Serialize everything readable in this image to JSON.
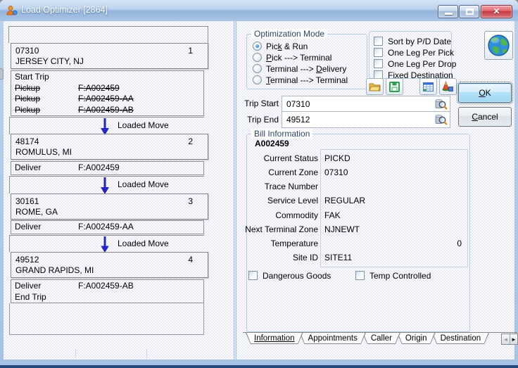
{
  "window": {
    "title": "Load Optimizer [2864]"
  },
  "trip_panel": {
    "connector_label": "Loaded Move",
    "stops": [
      {
        "zone": "07310",
        "city": "JERSEY CITY, NJ",
        "seq": "1",
        "actions": [
          {
            "label": "Start Trip",
            "value": "",
            "struck": false
          },
          {
            "label": "Pickup",
            "value": "F:A002459",
            "struck": true
          },
          {
            "label": "Pickup",
            "value": "F:A002459-AA",
            "struck": true
          },
          {
            "label": "Pickup",
            "value": "F:A002459-AB",
            "struck": true
          }
        ]
      },
      {
        "zone": "48174",
        "city": "ROMULUS, MI",
        "seq": "2",
        "actions": [
          {
            "label": "Deliver",
            "value": "F:A002459",
            "struck": false
          }
        ]
      },
      {
        "zone": "30161",
        "city": "ROME, GA",
        "seq": "3",
        "actions": [
          {
            "label": "Deliver",
            "value": "F:A002459-AA",
            "struck": false
          }
        ]
      },
      {
        "zone": "49512",
        "city": "GRAND RAPIDS, MI",
        "seq": "4",
        "actions": [
          {
            "label": "Deliver",
            "value": "F:A002459-AB",
            "struck": false
          },
          {
            "label": "End Trip",
            "value": "",
            "struck": false
          }
        ]
      }
    ]
  },
  "optimization": {
    "title": "Optimization Mode",
    "options": [
      {
        "label": "Pick & Run",
        "accel": 3,
        "selected": true
      },
      {
        "label": "Pick ---> Terminal",
        "accel": 0,
        "selected": false
      },
      {
        "label": "Terminal ---> Delivery",
        "accel": 14,
        "selected": false
      },
      {
        "label": "Terminal ---> Terminal",
        "accel": 0,
        "selected": false
      }
    ]
  },
  "flags": [
    {
      "label": "Sort by P/D Date",
      "checked": false
    },
    {
      "label": "One Leg Per Pick",
      "checked": false
    },
    {
      "label": "One Leg Per Drop",
      "checked": false
    },
    {
      "label": "Fixed Destination",
      "checked": false
    }
  ],
  "toolbar": {
    "icons": [
      "open-folder-icon",
      "save-icon",
      "report-grid-icon",
      "shapes-icon"
    ]
  },
  "fields": {
    "trip_start": {
      "label": "Trip Start",
      "value": "07310"
    },
    "trip_end": {
      "label": "Trip End",
      "value": "49512"
    }
  },
  "bill": {
    "title": "Bill Information",
    "bill_number": "A002459",
    "rows": [
      {
        "label": "Current Status",
        "value": "PICKD"
      },
      {
        "label": "Current Zone",
        "value": "07310"
      },
      {
        "label": "Trace Number",
        "value": ""
      },
      {
        "label": "Service Level",
        "value": "REGULAR"
      },
      {
        "label": "Commodity",
        "value": "FAK"
      },
      {
        "label": "Next Terminal Zone",
        "value": "NJNEWT"
      },
      {
        "label": "Temperature",
        "value": "0",
        "align": "right"
      },
      {
        "label": "Site ID",
        "value": "SITE11"
      }
    ],
    "checkboxes": [
      {
        "label": "Dangerous Goods",
        "checked": false
      },
      {
        "label": "Temp Controlled",
        "checked": false
      }
    ]
  },
  "tabs": {
    "items": [
      {
        "label": "Information",
        "active": true
      },
      {
        "label": "Appointments",
        "active": false
      },
      {
        "label": "Caller",
        "active": false
      },
      {
        "label": "Origin",
        "active": false
      },
      {
        "label": "Destination",
        "active": false
      }
    ]
  },
  "buttons": {
    "ok": "OK",
    "ok_accel": 0,
    "cancel": "Cancel",
    "cancel_accel": 0
  },
  "colors": {
    "titlebar_blue": "#9db9dd",
    "close_red": "#cf4148",
    "arrow_blue": "#2323c8",
    "focus_blue": "#3b8ad9"
  }
}
